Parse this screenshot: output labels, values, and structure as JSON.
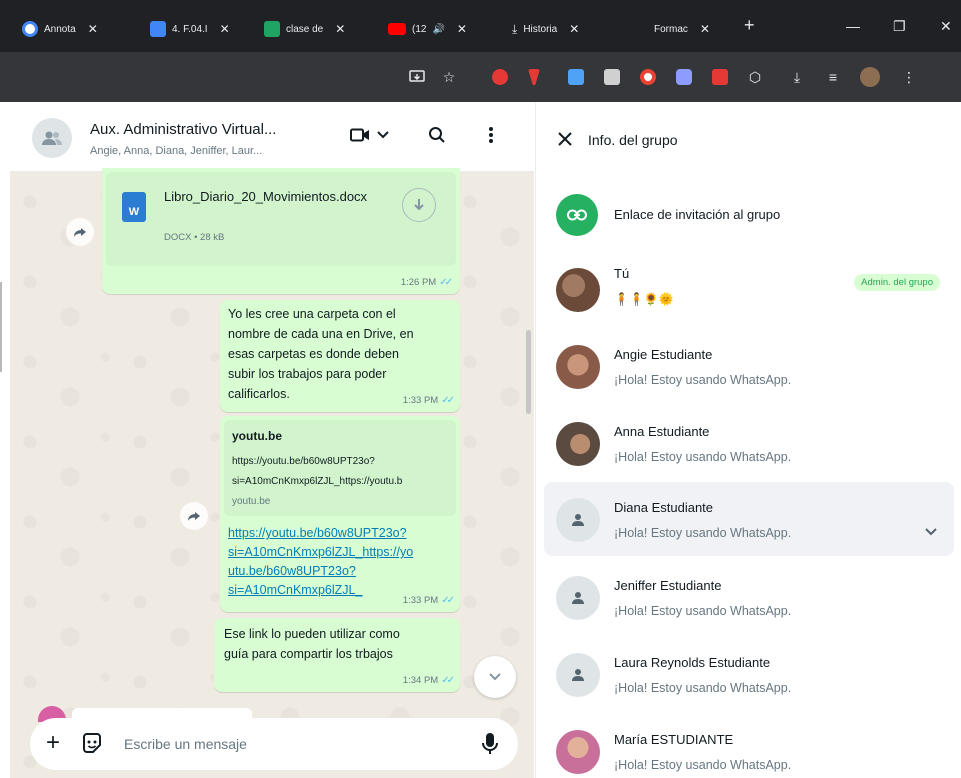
{
  "browser": {
    "tabs": [
      {
        "label": "Annota",
        "color": "#4285f4"
      },
      {
        "label": "4. F.04.I",
        "color": "#4285f4"
      },
      {
        "label": "clase de",
        "color": "#1fa463"
      },
      {
        "label": "(12",
        "color": "#ff0000"
      },
      {
        "label": "Historia",
        "color": "#e8eaed"
      },
      {
        "label": "Formac",
        "color": "#e8eaed"
      }
    ],
    "new_tab": "+",
    "close_glyph": "✕",
    "window": {
      "minimize": "—",
      "restore": "❐",
      "close": "✕"
    }
  },
  "chat": {
    "title": "Aux. Administrativo Virtual...",
    "participants": "Angie, Anna, Diana, Jeniffer, Laur...",
    "messages": {
      "document": {
        "filename": "Libro_Diario_20_Movimientos.docx",
        "meta": "DOCX • 28 kB",
        "time": "1:26 PM"
      },
      "m1": {
        "lines": [
          "Yo les cree una carpeta con el",
          "nombre de cada una en Drive, en",
          "esas carpetas es donde deben",
          "subir los trabajos para poder",
          "calificarlos."
        ],
        "time": "1:33 PM"
      },
      "m2": {
        "preview_title": "youtu.be",
        "preview_desc": [
          "https://youtu.be/b60w8UPT23o?",
          "si=A10mCnKmxp6lZJL_https://youtu.b"
        ],
        "preview_domain": "youtu.be",
        "link_lines": [
          "https://youtu.be/b60w8UPT23o?",
          "si=A10mCnKmxp6lZJL_https://yo",
          "utu.be/b60w8UPT23o?",
          "si=A10mCnKmxp6lZJL_"
        ],
        "time": "1:33 PM"
      },
      "m3": {
        "lines": [
          "Ese link lo pueden utilizar como",
          "guía para compartir los trbajos"
        ],
        "time": "1:34 PM"
      }
    },
    "composer": {
      "placeholder": "Escribe un mensaje"
    }
  },
  "group_info": {
    "title": "Info. del grupo",
    "invite_label": "Enlace de invitación al grupo",
    "members": [
      {
        "name": "Tú",
        "status": "🧍🧍🌻🌞",
        "badge": "Admin. del grupo",
        "avatar": "photo",
        "avatar_color": "#6b4a3a"
      },
      {
        "name": "Angie Estudiante",
        "status": "¡Hola! Estoy usando WhatsApp.",
        "avatar": "photo",
        "avatar_color": "#8a5a48"
      },
      {
        "name": "Anna Estudiante",
        "status": "¡Hola! Estoy usando WhatsApp.",
        "avatar": "photo",
        "avatar_color": "#5a4a3f"
      },
      {
        "name": "Diana Estudiante",
        "status": "¡Hola! Estoy usando WhatsApp.",
        "avatar": "default"
      },
      {
        "name": "Jeniffer Estudiante",
        "status": "¡Hola! Estoy usando WhatsApp.",
        "avatar": "default"
      },
      {
        "name": "Laura Reynolds Estudiante",
        "status": "¡Hola! Estoy usando WhatsApp.",
        "avatar": "default"
      },
      {
        "name": "María ESTUDIANTE",
        "status": "¡Hola! Estoy usando WhatsApp.",
        "avatar": "photo",
        "avatar_color": "#c9709a"
      }
    ]
  },
  "colors": {
    "accent_green": "#25b062",
    "bubble_out": "#d9fdd3",
    "read_ticks": "#53bdeb",
    "link": "#027eb5"
  }
}
